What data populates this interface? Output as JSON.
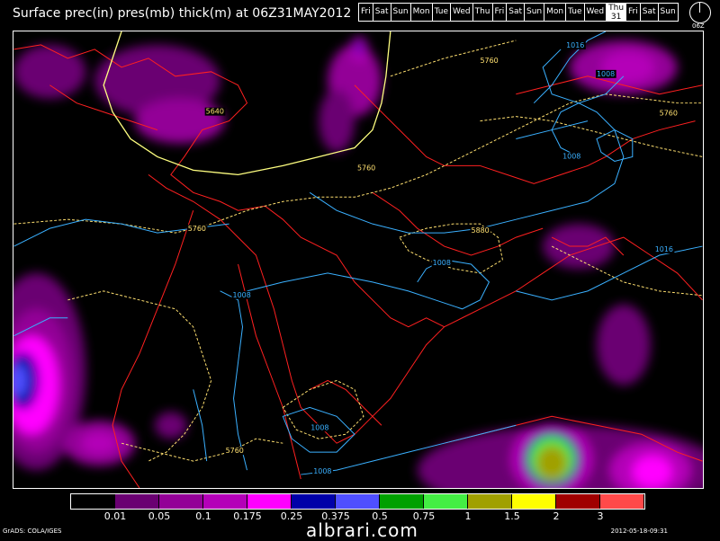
{
  "title": "Surface prec(in) pres(mb) thick(m) at 06Z31MAY2012",
  "days": [
    "Fri",
    "Sat",
    "Sun",
    "Mon",
    "Tue",
    "Wed",
    "Thu",
    "Fri",
    "Sat",
    "Sun",
    "Mon",
    "Tue",
    "Wed",
    "Thu",
    "Fri",
    "Sat",
    "Sun"
  ],
  "selected_day": {
    "name": "Thu",
    "date": "31"
  },
  "clock_label": "06Z",
  "legend": {
    "colors": [
      "#000000",
      "#6a0072",
      "#930097",
      "#b400b8",
      "#ff00ff",
      "#0000a8",
      "#4f4fff",
      "#00a000",
      "#44ee44",
      "#a0a000",
      "#ffff00",
      "#a00000",
      "#ff4a4a"
    ],
    "labels": [
      "0.01",
      "0.05",
      "0.1",
      "0.175",
      "0.25",
      "0.375",
      "0.5",
      "0.75",
      "1",
      "1.5",
      "2",
      "3"
    ]
  },
  "contour_labels": {
    "thickness": [
      "5760",
      "5640",
      "5760",
      "5760",
      "5880",
      "5760",
      "5760"
    ],
    "pressure": [
      "1016",
      "1008",
      "1008",
      "1008",
      "1008",
      "1008",
      "1008",
      "1016"
    ]
  },
  "colors": {
    "thickness": "#ffe070",
    "thickness_5640": "#ffff80",
    "pressure": "#3ab0ff",
    "coast": "#ff2020"
  },
  "footer_left": "GrADS: COLA/IGES",
  "footer_right": "2012-05-18-09:31",
  "watermark": "albrari.com"
}
